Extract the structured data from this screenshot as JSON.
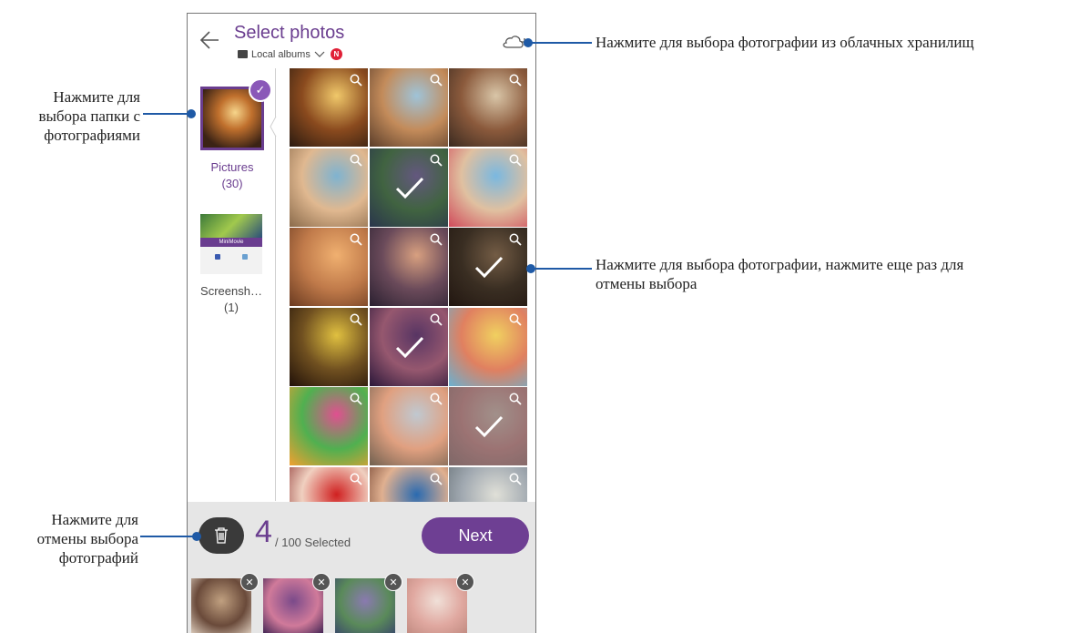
{
  "header": {
    "title": "Select photos",
    "subtitle": "Local albums",
    "new_badge": "N"
  },
  "albums": [
    {
      "name": "Pictures",
      "count": "(30)",
      "selected": true
    },
    {
      "name": "Screensh…",
      "count": "(1)",
      "selected": false,
      "thumb_text": "MiniMovie"
    }
  ],
  "photos": [
    {
      "selected": false,
      "colors": [
        "#f0c86a",
        "#8a4a1e",
        "#2a1a10"
      ]
    },
    {
      "selected": false,
      "colors": [
        "#9fc3d8",
        "#c38b5a",
        "#5a3d2a"
      ]
    },
    {
      "selected": false,
      "colors": [
        "#d9c6a8",
        "#8b5a3c",
        "#3a2a20"
      ]
    },
    {
      "selected": false,
      "colors": [
        "#7fb3d0",
        "#e0b890",
        "#8a6a4a"
      ]
    },
    {
      "selected": true,
      "colors": [
        "#8a7ab0",
        "#5a8a5a",
        "#3a4a6a"
      ]
    },
    {
      "selected": false,
      "colors": [
        "#7ab8e0",
        "#e0c0a0",
        "#d04a5a"
      ]
    },
    {
      "selected": false,
      "colors": [
        "#f0b070",
        "#c07a4a",
        "#6a3a20"
      ]
    },
    {
      "selected": false,
      "colors": [
        "#d8a080",
        "#6a4a5a",
        "#2a2030"
      ]
    },
    {
      "selected": true,
      "colors": [
        "#a08060",
        "#504030",
        "#302018"
      ]
    },
    {
      "selected": false,
      "colors": [
        "#e0c040",
        "#705020",
        "#201008"
      ]
    },
    {
      "selected": true,
      "colors": [
        "#7a4a8a",
        "#d07a9a",
        "#3a2050"
      ]
    },
    {
      "selected": false,
      "colors": [
        "#f0d060",
        "#e08060",
        "#6ab0d0"
      ]
    },
    {
      "selected": false,
      "colors": [
        "#e05090",
        "#50b050",
        "#f0a030"
      ]
    },
    {
      "selected": false,
      "colors": [
        "#c0c8d0",
        "#e0a080",
        "#706050"
      ]
    },
    {
      "selected": true,
      "colors": [
        "#e0c8c0",
        "#d8a0a0",
        "#b09090"
      ]
    },
    {
      "selected": false,
      "colors": [
        "#d02020",
        "#f0d0c0",
        "#802020"
      ]
    },
    {
      "selected": false,
      "colors": [
        "#2a6ab0",
        "#e0b090",
        "#603020"
      ]
    },
    {
      "selected": false,
      "colors": [
        "#e0e0d8",
        "#a0a8b0",
        "#606a70"
      ]
    }
  ],
  "bottom": {
    "count": "4",
    "total": "/ 100 Selected",
    "next": "Next",
    "selected_thumbs": [
      {
        "colors": [
          "#c0a080",
          "#6a4a3a",
          "#e0d0c0"
        ]
      },
      {
        "colors": [
          "#7a4a8a",
          "#d07a9a",
          "#3a2050"
        ]
      },
      {
        "colors": [
          "#8a7ab0",
          "#5a8a5a",
          "#3a4a6a"
        ]
      },
      {
        "colors": [
          "#f0e0d8",
          "#e0a8a0",
          "#c08a80"
        ]
      }
    ]
  },
  "callouts": {
    "cloud": "Нажмите для выбора фотографии из облачных хранилищ",
    "folder": [
      "Нажмите для",
      "выбора папки с",
      "фотографиями"
    ],
    "photo": [
      "Нажмите для выбора фотографии, нажмите еще раз для",
      "отмены выбора"
    ],
    "deselect": [
      "Нажмите для",
      "отмены выбора",
      "фотографий"
    ]
  },
  "colors": {
    "accent": "#6a3d8f",
    "callout_line": "#1f5aa6"
  },
  "icons": [
    "back-arrow-icon",
    "cloud-add-icon",
    "chevron-down-icon",
    "zoom-icon",
    "checkmark-icon",
    "trash-icon",
    "close-icon"
  ]
}
